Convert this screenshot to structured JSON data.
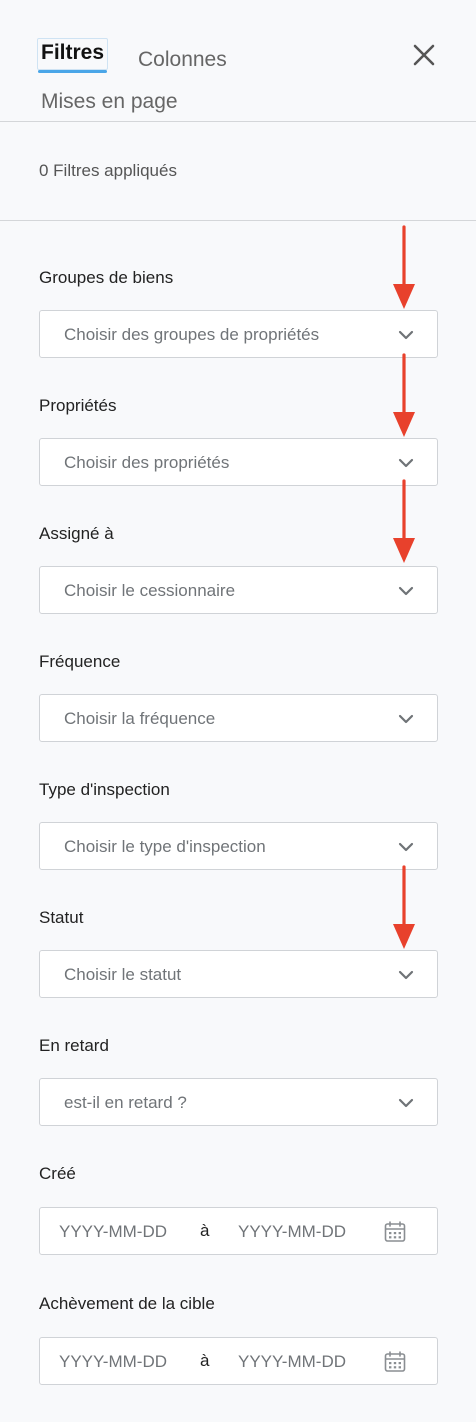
{
  "tabs": {
    "filtres": "Filtres",
    "colonnes": "Colonnes",
    "mises_en_page": "Mises en page"
  },
  "summary": {
    "applied": "0 Filtres appliqués"
  },
  "filters": {
    "groupes": {
      "label": "Groupes de biens",
      "placeholder": "Choisir des groupes de propriétés"
    },
    "proprietes": {
      "label": "Propriétés",
      "placeholder": "Choisir des propriétés"
    },
    "assigne": {
      "label": "Assigné à",
      "placeholder": "Choisir le cessionnaire"
    },
    "frequence": {
      "label": "Fréquence",
      "placeholder": "Choisir la fréquence"
    },
    "type": {
      "label": "Type d'inspection",
      "placeholder": "Choisir le type d'inspection"
    },
    "statut": {
      "label": "Statut",
      "placeholder": "Choisir le statut"
    },
    "retard": {
      "label": "En retard",
      "placeholder": "est-il en retard ?"
    },
    "cree": {
      "label": "Créé",
      "from_placeholder": "YYYY-MM-DD",
      "separator": "à",
      "to_placeholder": "YYYY-MM-DD"
    },
    "achevement": {
      "label": "Achèvement de la cible",
      "from_placeholder": "YYYY-MM-DD",
      "separator": "à",
      "to_placeholder": "YYYY-MM-DD"
    }
  },
  "annotations": {
    "arrow_color": "#e8412c"
  },
  "colors": {
    "accent": "#4aa6e8",
    "background": "#f8f9fb"
  },
  "icons": [
    "close-icon",
    "chevron-down-icon",
    "calendar-icon",
    "red-arrow-annotation"
  ]
}
